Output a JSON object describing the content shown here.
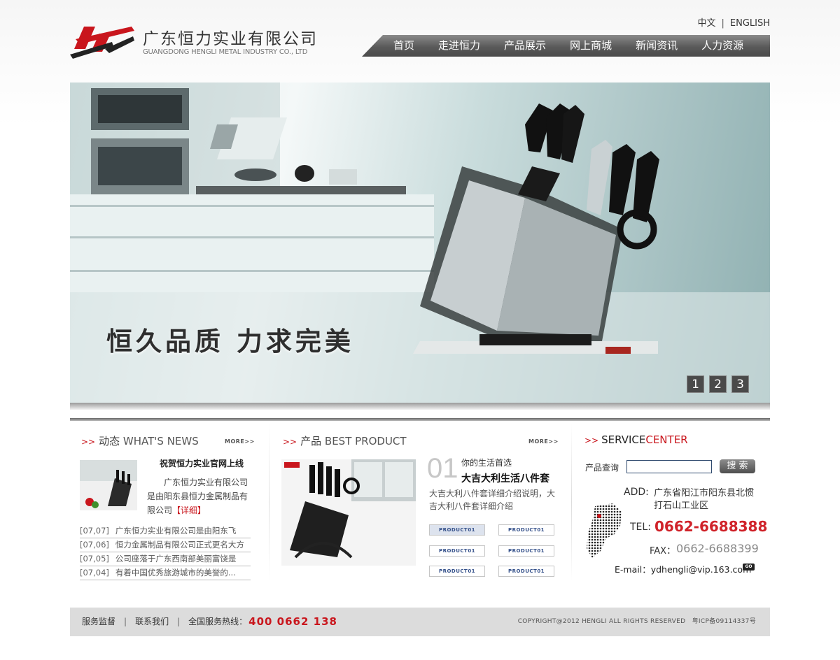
{
  "header": {
    "company_cn": "广东恒力实业有限公司",
    "company_en": "GUANGDONG HENGLI METAL INDUSTRY CO., LTD",
    "logo_text": "HENGLI",
    "lang_cn": "中文",
    "lang_sep": "|",
    "lang_en": "ENGLISH"
  },
  "nav": {
    "items": [
      {
        "label": "首页"
      },
      {
        "label": "走进恒力"
      },
      {
        "label": "产品展示"
      },
      {
        "label": "网上商城"
      },
      {
        "label": "新闻资讯"
      },
      {
        "label": "人力资源"
      }
    ]
  },
  "banner": {
    "slogan": "恒久品质 力求完美",
    "pages": [
      "1",
      "2",
      "3"
    ]
  },
  "news": {
    "arrow": ">>",
    "title_cn": "动态",
    "title_en": "WHAT'S NEWS",
    "more": "MORE>>",
    "headline": "祝贺恒力实业官网上线",
    "summary": "广东恒力实业有限公司是由阳东县恒力金属制品有限公司",
    "detail_label": "【详细】",
    "items": [
      {
        "date": "[07,07]",
        "title": "广东恒力实业有限公司是由阳东飞"
      },
      {
        "date": "[07,06]",
        "title": "恒力金属制品有限公司正式更名大方"
      },
      {
        "date": "[07,05]",
        "title": "公司座落于广东西南部美丽富饶是"
      },
      {
        "date": "[07,04]",
        "title": "有着中国优秀旅游城市的美誉的..."
      }
    ]
  },
  "product": {
    "arrow": ">>",
    "title_cn": "产品",
    "title_en": "BEST PRODUCT",
    "more": "MORE>>",
    "num": "01",
    "tagline": "你的生活首选",
    "name": "大吉大利生活八件套",
    "description": "大吉大利八件套详细介绍说明，大吉大利八件套详细介绍",
    "buttons": [
      "PRODUCT01",
      "PRODUCT01",
      "PRODUCT01",
      "PRODUCT01",
      "PRODUCT01",
      "PRODUCT01"
    ]
  },
  "service": {
    "arrow": ">>",
    "title_a": "SERVICE",
    "title_b": "CENTER",
    "search_label": "产品查询",
    "search_value": "",
    "search_button": "搜 索",
    "addr_label": "ADD:",
    "address": "广东省阳江市阳东县北惯打石山工业区",
    "tel_label": "TEL:",
    "tel": "0662-6688388",
    "fax_label": "FAX：",
    "fax": "0662-6688399",
    "email": "E-mail：ydhengli@vip.163.com",
    "go": "GO"
  },
  "footer": {
    "link1": "服务监督",
    "link2": "联系我们",
    "sep": "|",
    "hotline_label": "全国服务热线：",
    "hotline": "400 0662 138",
    "copyright": "COPYRIGHT@2012 HENGLI ALL RIGHTS RESERVED　粤ICP备09114337号"
  },
  "colors": {
    "accent_red": "#c9161d",
    "nav_gray": "#5a5a5a",
    "footer_bg": "#dcdcdc"
  }
}
